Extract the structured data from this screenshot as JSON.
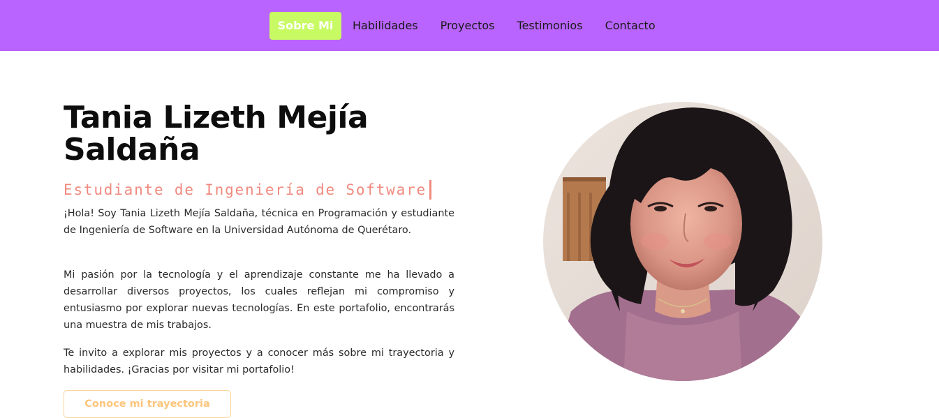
{
  "nav": {
    "items": [
      {
        "label": "Sobre Mi",
        "active": true
      },
      {
        "label": "Habilidades",
        "active": false
      },
      {
        "label": "Proyectos",
        "active": false
      },
      {
        "label": "Testimonios",
        "active": false
      },
      {
        "label": "Contacto",
        "active": false
      }
    ]
  },
  "hero": {
    "name": "Tania Lizeth Mejía Saldaña",
    "subtitle": "Estudiante de Ingeniería de Software",
    "paragraphs": [
      "¡Hola! Soy Tania Lizeth Mejía Saldaña, técnica en Programación y estudiante de Ingeniería de Software en la Universidad Autónoma de Querétaro.",
      "Mi pasión por la tecnología y el aprendizaje constante me ha llevado a desarrollar diversos proyectos, los cuales reflejan mi compromiso y entusiasmo por explorar nuevas tecnologías. En este portafolio, encontrarás una muestra de mis trabajos.",
      "Te invito a explorar mis proyectos y a conocer más sobre mi trayectoria y habilidades. ¡Gracias por visitar mi portafolio!"
    ],
    "cta_label": "Conoce mi trayectoria"
  },
  "colors": {
    "nav_background": "#b964fe",
    "nav_active": "#c8fa64",
    "subtitle": "#f08a7f",
    "cta_text": "#fcc57c",
    "cta_border": "#fcd49a"
  }
}
